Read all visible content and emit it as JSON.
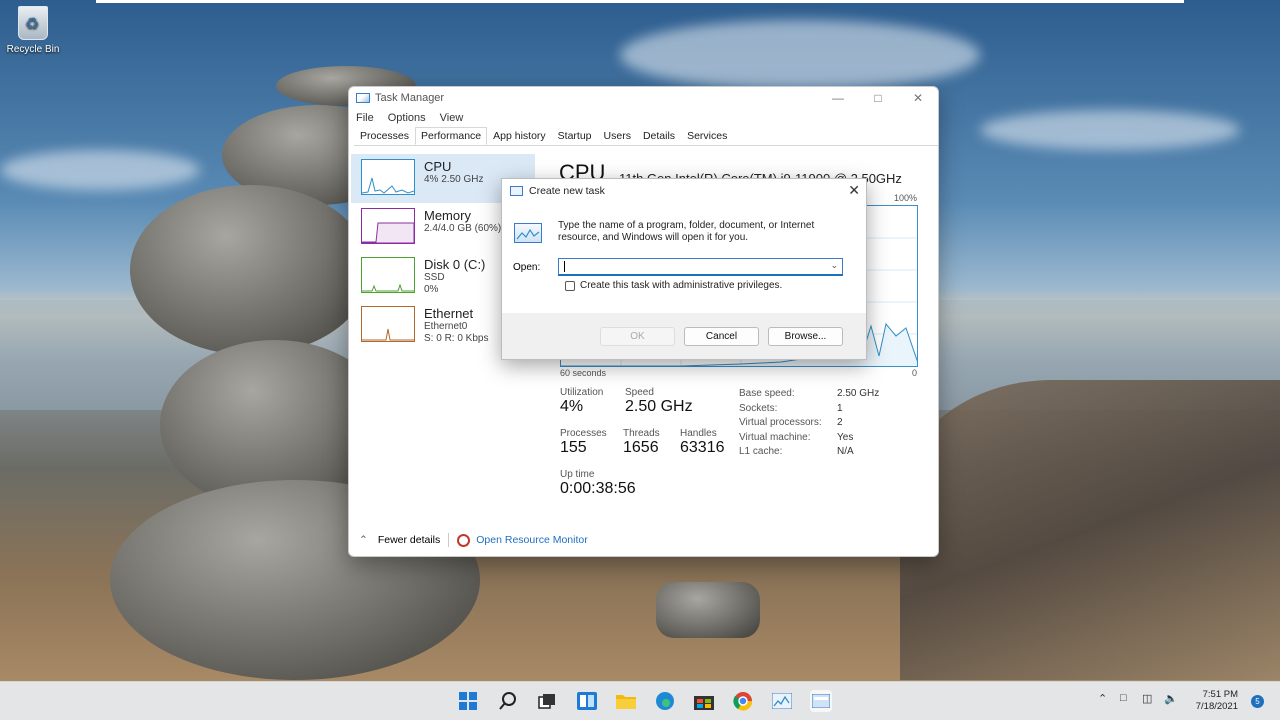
{
  "desktop": {
    "recycle_bin_label": "Recycle Bin"
  },
  "task_manager": {
    "title": "Task Manager",
    "menu": [
      "File",
      "Options",
      "View"
    ],
    "tabs": [
      "Processes",
      "Performance",
      "App history",
      "Startup",
      "Users",
      "Details",
      "Services"
    ],
    "active_tab": "Performance",
    "resources": [
      {
        "name": "CPU",
        "line1": "4%  2.50 GHz",
        "line2": "",
        "color": "#2f8fc9"
      },
      {
        "name": "Memory",
        "line1": "2.4/4.0 GB (60%)",
        "line2": "",
        "color": "#8b2fa0"
      },
      {
        "name": "Disk 0 (C:)",
        "line1": "SSD",
        "line2": "0%",
        "color": "#4ea02f"
      },
      {
        "name": "Ethernet",
        "line1": "Ethernet0",
        "line2": "S: 0  R: 0 Kbps",
        "color": "#b0682c"
      }
    ],
    "cpu": {
      "heading": "CPU",
      "model": "11th Gen Intel(R) Core(TM) i9-11900 @ 2.50GHz",
      "graph_max_label": "100%",
      "graph_time_label": "60 seconds",
      "graph_min_label": "0",
      "utilization_label": "Utilization",
      "utilization": "4%",
      "speed_label": "Speed",
      "speed": "2.50 GHz",
      "processes_label": "Processes",
      "processes": "155",
      "threads_label": "Threads",
      "threads": "1656",
      "handles_label": "Handles",
      "handles": "63316",
      "uptime_label": "Up time",
      "uptime": "0:00:38:56",
      "details": [
        {
          "k": "Base speed:",
          "v": "2.50 GHz"
        },
        {
          "k": "Sockets:",
          "v": "1"
        },
        {
          "k": "Virtual processors:",
          "v": "2"
        },
        {
          "k": "Virtual machine:",
          "v": "Yes"
        },
        {
          "k": "L1 cache:",
          "v": "N/A"
        }
      ]
    },
    "footer": {
      "fewer_details": "Fewer details",
      "resource_monitor": "Open Resource Monitor"
    }
  },
  "dialog": {
    "title": "Create new task",
    "description": "Type the name of a program, folder, document, or Internet resource, and Windows will open it for you.",
    "open_label": "Open:",
    "open_value": "",
    "admin_checkbox_label": "Create this task with administrative privileges.",
    "ok": "OK",
    "cancel": "Cancel",
    "browse": "Browse..."
  },
  "taskbar": {
    "time": "7:51 PM",
    "date": "7/18/2021",
    "notifications": "5"
  }
}
